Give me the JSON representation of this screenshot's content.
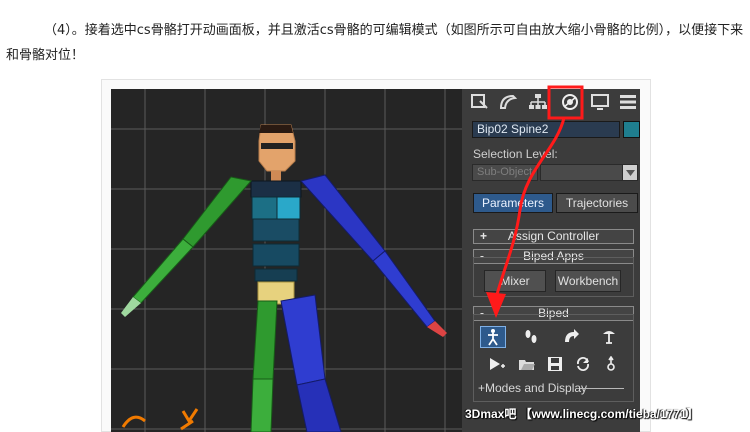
{
  "article": {
    "step_number": "（4）",
    "paragraph_text": "。接着选中cs骨骼打开动画面板，并且激活cs骨骼的可编辑模式（如图所示可自由放大缩小骨骼的比例），以便接下来和骨骼对位！"
  },
  "command_panel": {
    "tabs": [
      {
        "icon": "create-icon"
      },
      {
        "icon": "modify-icon"
      },
      {
        "icon": "hierarchy-icon"
      },
      {
        "icon": "motion-icon"
      },
      {
        "icon": "display-icon"
      },
      {
        "icon": "utilities-icon"
      }
    ],
    "object_name": "Bip02 Spine2",
    "object_color": "#1f7e8f",
    "selection_level_label": "Selection Level:",
    "selection_level_value": "Sub-Object",
    "params_button": "Parameters",
    "trajectories_button": "Trajectories",
    "rollouts": {
      "assign_controller": {
        "sign": "+",
        "label": "Assign Controller"
      },
      "biped_apps": {
        "sign": "-",
        "label": "Biped Apps"
      },
      "biped": {
        "sign": "-",
        "label": "Biped"
      }
    },
    "mixer_button": "Mixer",
    "workbench_button": "Workbench",
    "biped_icons_row1": [
      "figure-mode-icon",
      "footstep-mode-icon",
      "motion-flow-icon",
      "mixer-mode-icon"
    ],
    "biped_icons_row2": [
      "create-key-icon",
      "open-file-icon",
      "save-file-icon",
      "convert-icon",
      "move-all-icon"
    ],
    "modes_display": "+Modes and Display"
  },
  "watermark": "3Dmax吧 【www.linecg.com/tieba/1771】",
  "colors": {
    "accent_red": "#ff1a1a",
    "panel_bg": "#3c3c3c",
    "viewport_bg": "#252525",
    "active_blue": "#2e5a8c"
  }
}
